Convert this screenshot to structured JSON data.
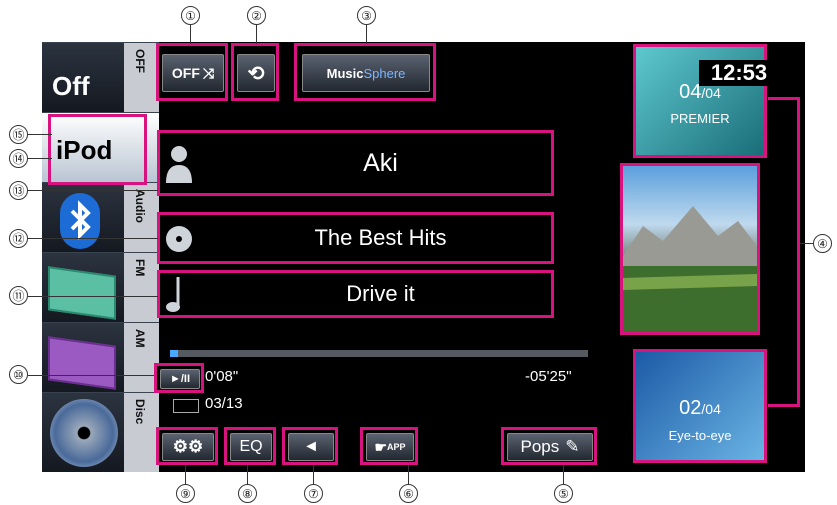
{
  "sources": [
    {
      "id": "off",
      "label": "Off",
      "strip": "OFF"
    },
    {
      "id": "ipod",
      "label": "iPod",
      "strip": ""
    },
    {
      "id": "bt",
      "label": "",
      "strip": "Audio"
    },
    {
      "id": "fm",
      "label": "",
      "strip": "FM"
    },
    {
      "id": "am",
      "label": "",
      "strip": "AM"
    },
    {
      "id": "disc",
      "label": "",
      "strip": "Disc"
    }
  ],
  "top_controls": {
    "shuffle_label": "OFF",
    "musicsphere_label_a": "Music",
    "musicsphere_label_b": "Sphere"
  },
  "clock": "12:53",
  "next_track": {
    "counter_num": "04",
    "counter_den": "/04",
    "title": "PREMIER"
  },
  "prev_track": {
    "counter_num": "02",
    "counter_den": "/04",
    "title": "Eye-to-eye"
  },
  "track_info": {
    "artist": "Aki",
    "album": "The Best Hits",
    "song": "Drive it"
  },
  "playback": {
    "play_pause_label": "►/II",
    "elapsed": "0'08\"",
    "remaining": "-05'25\"",
    "track_counter": "03/13",
    "progress_fraction": 0.02
  },
  "bottom_buttons": {
    "eq_label": "EQ",
    "app_label": "APP",
    "genre_label": "Pops"
  },
  "callouts": [
    "①",
    "②",
    "③",
    "④",
    "⑤",
    "⑥",
    "⑦",
    "⑧",
    "⑨",
    "⑩",
    "⑪",
    "⑫",
    "⑬",
    "⑭",
    "⑮"
  ],
  "colors": {
    "highlight": "#d8127e",
    "progress": "#4aa8ff"
  }
}
